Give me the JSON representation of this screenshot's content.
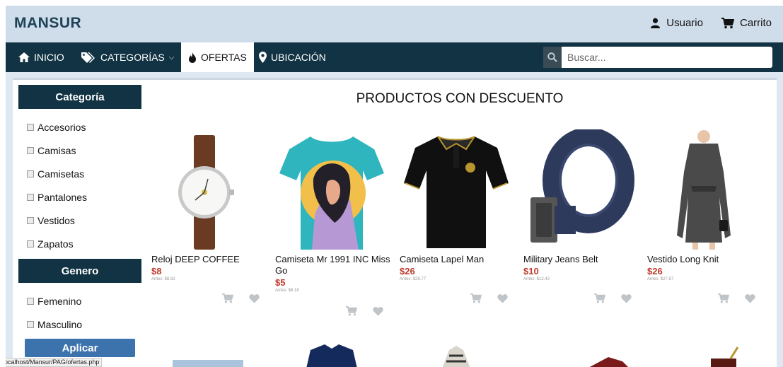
{
  "header": {
    "logo": "MANSUR",
    "user_label": "Usuario",
    "cart_label": "Carrito"
  },
  "nav": {
    "items": [
      {
        "label": "INICIO",
        "icon": "home-icon"
      },
      {
        "label": "CATEGORÍAS",
        "icon": "tags-icon",
        "dropdown": true
      },
      {
        "label": "OFERTAS",
        "icon": "fire-icon",
        "active": true
      },
      {
        "label": "UBICACIÓN",
        "icon": "map-marker-icon"
      }
    ],
    "search_placeholder": "Buscar..."
  },
  "sidebar": {
    "category_title": "Categoría",
    "categories": [
      "Accesorios",
      "Camisas",
      "Camisetas",
      "Pantalones",
      "Vestidos",
      "Zapatos"
    ],
    "gender_title": "Genero",
    "genders": [
      "Femenino",
      "Masculino"
    ],
    "apply_label": "Aplicar"
  },
  "main": {
    "title": "PRODUCTOS CON DESCUENTO",
    "products": [
      {
        "name": "Reloj DEEP COFFEE",
        "price": "$8",
        "old": "Antes: $8.82",
        "image": "watch"
      },
      {
        "name": "Camiseta Mr 1991 INC Miss Go",
        "price": "$5",
        "old": "Antes: $6.18",
        "image": "tshirt"
      },
      {
        "name": "Camiseta Lapel Man",
        "price": "$26",
        "old": "Antes: $29.77",
        "image": "polo"
      },
      {
        "name": "Military Jeans Belt",
        "price": "$10",
        "old": "Antes: $12.42",
        "image": "belt"
      },
      {
        "name": "Vestido Long Knit",
        "price": "$26",
        "old": "Antes: $27.87",
        "image": "dress"
      }
    ]
  },
  "status_bar": "localhost/Mansur/PAG/ofertas.php",
  "colors": {
    "nav_bg": "#113343",
    "topbar_bg": "#cfdcea",
    "accent_button": "#3d73ad",
    "price": "#c0392b"
  }
}
